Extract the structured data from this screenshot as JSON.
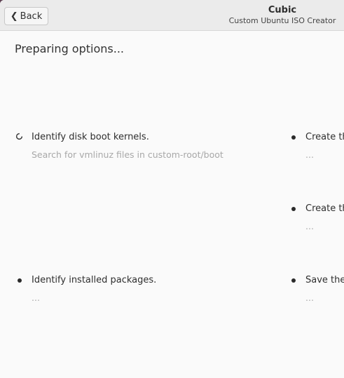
{
  "header": {
    "back_label": "Back",
    "app_title": "Cubic",
    "app_subtitle": "Custom Ubuntu ISO Creator"
  },
  "page": {
    "title": "Preparing options..."
  },
  "steps": [
    {
      "label": "Identify disk boot kernels.",
      "detail": "Search for vmlinuz files in custom-root/boot",
      "status": "in-progress"
    },
    {
      "label": "Identify installed packages.",
      "detail": "...",
      "status": "pending"
    },
    {
      "label": "Create the",
      "detail": "...",
      "status": "pending"
    },
    {
      "label": "Create the",
      "detail": "...",
      "status": "pending"
    },
    {
      "label": "Save the p",
      "detail": "...",
      "status": "pending"
    }
  ]
}
